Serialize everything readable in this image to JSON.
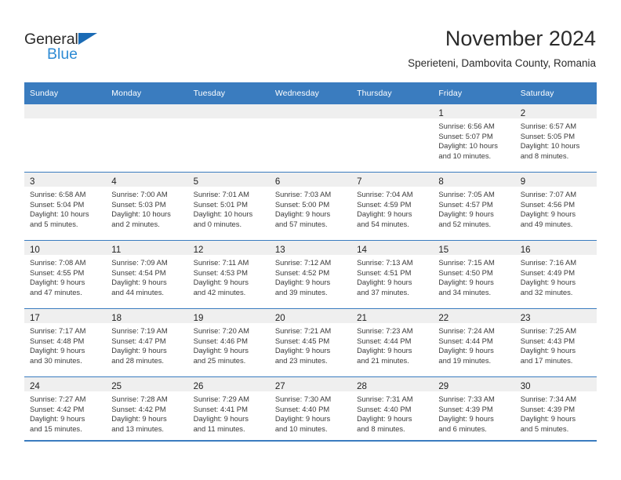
{
  "brand": {
    "name_part1": "General",
    "name_part2": "Blue",
    "triangle_icon": "triangle-icon",
    "accent_dark": "#1b6bb5",
    "accent_light": "#2e8bd4"
  },
  "header": {
    "month_title": "November 2024",
    "location": "Sperieteni, Dambovita County, Romania"
  },
  "calendar": {
    "header_color": "#3a7cbf",
    "daynum_band_color": "#efefef",
    "weekdays": [
      "Sunday",
      "Monday",
      "Tuesday",
      "Wednesday",
      "Thursday",
      "Friday",
      "Saturday"
    ],
    "weeks": [
      [
        {
          "day": "",
          "empty": true,
          "sunrise": "",
          "sunset": "",
          "daylight_line1": "",
          "daylight_line2": ""
        },
        {
          "day": "",
          "empty": true,
          "sunrise": "",
          "sunset": "",
          "daylight_line1": "",
          "daylight_line2": ""
        },
        {
          "day": "",
          "empty": true,
          "sunrise": "",
          "sunset": "",
          "daylight_line1": "",
          "daylight_line2": ""
        },
        {
          "day": "",
          "empty": true,
          "sunrise": "",
          "sunset": "",
          "daylight_line1": "",
          "daylight_line2": ""
        },
        {
          "day": "",
          "empty": true,
          "sunrise": "",
          "sunset": "",
          "daylight_line1": "",
          "daylight_line2": ""
        },
        {
          "day": "1",
          "empty": false,
          "sunrise": "Sunrise: 6:56 AM",
          "sunset": "Sunset: 5:07 PM",
          "daylight_line1": "Daylight: 10 hours",
          "daylight_line2": "and 10 minutes."
        },
        {
          "day": "2",
          "empty": false,
          "sunrise": "Sunrise: 6:57 AM",
          "sunset": "Sunset: 5:05 PM",
          "daylight_line1": "Daylight: 10 hours",
          "daylight_line2": "and 8 minutes."
        }
      ],
      [
        {
          "day": "3",
          "empty": false,
          "sunrise": "Sunrise: 6:58 AM",
          "sunset": "Sunset: 5:04 PM",
          "daylight_line1": "Daylight: 10 hours",
          "daylight_line2": "and 5 minutes."
        },
        {
          "day": "4",
          "empty": false,
          "sunrise": "Sunrise: 7:00 AM",
          "sunset": "Sunset: 5:03 PM",
          "daylight_line1": "Daylight: 10 hours",
          "daylight_line2": "and 2 minutes."
        },
        {
          "day": "5",
          "empty": false,
          "sunrise": "Sunrise: 7:01 AM",
          "sunset": "Sunset: 5:01 PM",
          "daylight_line1": "Daylight: 10 hours",
          "daylight_line2": "and 0 minutes."
        },
        {
          "day": "6",
          "empty": false,
          "sunrise": "Sunrise: 7:03 AM",
          "sunset": "Sunset: 5:00 PM",
          "daylight_line1": "Daylight: 9 hours",
          "daylight_line2": "and 57 minutes."
        },
        {
          "day": "7",
          "empty": false,
          "sunrise": "Sunrise: 7:04 AM",
          "sunset": "Sunset: 4:59 PM",
          "daylight_line1": "Daylight: 9 hours",
          "daylight_line2": "and 54 minutes."
        },
        {
          "day": "8",
          "empty": false,
          "sunrise": "Sunrise: 7:05 AM",
          "sunset": "Sunset: 4:57 PM",
          "daylight_line1": "Daylight: 9 hours",
          "daylight_line2": "and 52 minutes."
        },
        {
          "day": "9",
          "empty": false,
          "sunrise": "Sunrise: 7:07 AM",
          "sunset": "Sunset: 4:56 PM",
          "daylight_line1": "Daylight: 9 hours",
          "daylight_line2": "and 49 minutes."
        }
      ],
      [
        {
          "day": "10",
          "empty": false,
          "sunrise": "Sunrise: 7:08 AM",
          "sunset": "Sunset: 4:55 PM",
          "daylight_line1": "Daylight: 9 hours",
          "daylight_line2": "and 47 minutes."
        },
        {
          "day": "11",
          "empty": false,
          "sunrise": "Sunrise: 7:09 AM",
          "sunset": "Sunset: 4:54 PM",
          "daylight_line1": "Daylight: 9 hours",
          "daylight_line2": "and 44 minutes."
        },
        {
          "day": "12",
          "empty": false,
          "sunrise": "Sunrise: 7:11 AM",
          "sunset": "Sunset: 4:53 PM",
          "daylight_line1": "Daylight: 9 hours",
          "daylight_line2": "and 42 minutes."
        },
        {
          "day": "13",
          "empty": false,
          "sunrise": "Sunrise: 7:12 AM",
          "sunset": "Sunset: 4:52 PM",
          "daylight_line1": "Daylight: 9 hours",
          "daylight_line2": "and 39 minutes."
        },
        {
          "day": "14",
          "empty": false,
          "sunrise": "Sunrise: 7:13 AM",
          "sunset": "Sunset: 4:51 PM",
          "daylight_line1": "Daylight: 9 hours",
          "daylight_line2": "and 37 minutes."
        },
        {
          "day": "15",
          "empty": false,
          "sunrise": "Sunrise: 7:15 AM",
          "sunset": "Sunset: 4:50 PM",
          "daylight_line1": "Daylight: 9 hours",
          "daylight_line2": "and 34 minutes."
        },
        {
          "day": "16",
          "empty": false,
          "sunrise": "Sunrise: 7:16 AM",
          "sunset": "Sunset: 4:49 PM",
          "daylight_line1": "Daylight: 9 hours",
          "daylight_line2": "and 32 minutes."
        }
      ],
      [
        {
          "day": "17",
          "empty": false,
          "sunrise": "Sunrise: 7:17 AM",
          "sunset": "Sunset: 4:48 PM",
          "daylight_line1": "Daylight: 9 hours",
          "daylight_line2": "and 30 minutes."
        },
        {
          "day": "18",
          "empty": false,
          "sunrise": "Sunrise: 7:19 AM",
          "sunset": "Sunset: 4:47 PM",
          "daylight_line1": "Daylight: 9 hours",
          "daylight_line2": "and 28 minutes."
        },
        {
          "day": "19",
          "empty": false,
          "sunrise": "Sunrise: 7:20 AM",
          "sunset": "Sunset: 4:46 PM",
          "daylight_line1": "Daylight: 9 hours",
          "daylight_line2": "and 25 minutes."
        },
        {
          "day": "20",
          "empty": false,
          "sunrise": "Sunrise: 7:21 AM",
          "sunset": "Sunset: 4:45 PM",
          "daylight_line1": "Daylight: 9 hours",
          "daylight_line2": "and 23 minutes."
        },
        {
          "day": "21",
          "empty": false,
          "sunrise": "Sunrise: 7:23 AM",
          "sunset": "Sunset: 4:44 PM",
          "daylight_line1": "Daylight: 9 hours",
          "daylight_line2": "and 21 minutes."
        },
        {
          "day": "22",
          "empty": false,
          "sunrise": "Sunrise: 7:24 AM",
          "sunset": "Sunset: 4:44 PM",
          "daylight_line1": "Daylight: 9 hours",
          "daylight_line2": "and 19 minutes."
        },
        {
          "day": "23",
          "empty": false,
          "sunrise": "Sunrise: 7:25 AM",
          "sunset": "Sunset: 4:43 PM",
          "daylight_line1": "Daylight: 9 hours",
          "daylight_line2": "and 17 minutes."
        }
      ],
      [
        {
          "day": "24",
          "empty": false,
          "sunrise": "Sunrise: 7:27 AM",
          "sunset": "Sunset: 4:42 PM",
          "daylight_line1": "Daylight: 9 hours",
          "daylight_line2": "and 15 minutes."
        },
        {
          "day": "25",
          "empty": false,
          "sunrise": "Sunrise: 7:28 AM",
          "sunset": "Sunset: 4:42 PM",
          "daylight_line1": "Daylight: 9 hours",
          "daylight_line2": "and 13 minutes."
        },
        {
          "day": "26",
          "empty": false,
          "sunrise": "Sunrise: 7:29 AM",
          "sunset": "Sunset: 4:41 PM",
          "daylight_line1": "Daylight: 9 hours",
          "daylight_line2": "and 11 minutes."
        },
        {
          "day": "27",
          "empty": false,
          "sunrise": "Sunrise: 7:30 AM",
          "sunset": "Sunset: 4:40 PM",
          "daylight_line1": "Daylight: 9 hours",
          "daylight_line2": "and 10 minutes."
        },
        {
          "day": "28",
          "empty": false,
          "sunrise": "Sunrise: 7:31 AM",
          "sunset": "Sunset: 4:40 PM",
          "daylight_line1": "Daylight: 9 hours",
          "daylight_line2": "and 8 minutes."
        },
        {
          "day": "29",
          "empty": false,
          "sunrise": "Sunrise: 7:33 AM",
          "sunset": "Sunset: 4:39 PM",
          "daylight_line1": "Daylight: 9 hours",
          "daylight_line2": "and 6 minutes."
        },
        {
          "day": "30",
          "empty": false,
          "sunrise": "Sunrise: 7:34 AM",
          "sunset": "Sunset: 4:39 PM",
          "daylight_line1": "Daylight: 9 hours",
          "daylight_line2": "and 5 minutes."
        }
      ]
    ]
  }
}
